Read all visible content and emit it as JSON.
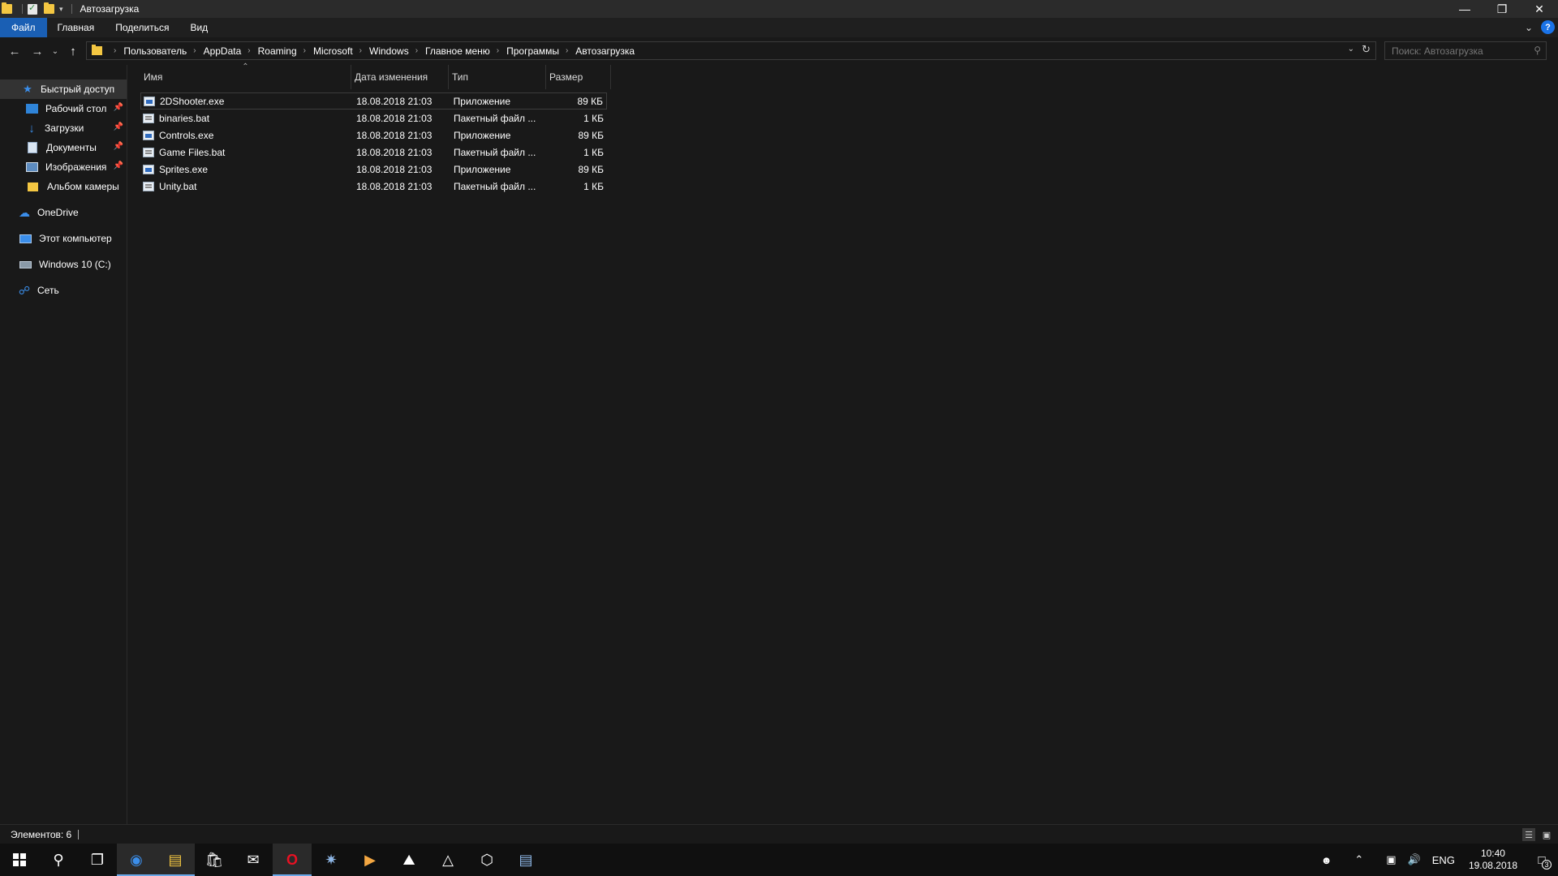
{
  "window": {
    "title": "Автозагрузка",
    "qat_dropdown": "▾"
  },
  "ribbon": {
    "tabs": [
      "Файл",
      "Главная",
      "Поделиться",
      "Вид"
    ],
    "help": "?"
  },
  "address": {
    "breadcrumbs": [
      "Пользователь",
      "AppData",
      "Roaming",
      "Microsoft",
      "Windows",
      "Главное меню",
      "Программы",
      "Автозагрузка"
    ]
  },
  "search": {
    "placeholder": "Поиск: Автозагрузка"
  },
  "sidebar": {
    "items": [
      {
        "label": "Быстрый доступ",
        "icon": "star-icon"
      },
      {
        "label": "Рабочий стол",
        "icon": "desktop-icon"
      },
      {
        "label": "Загрузки",
        "icon": "download-icon"
      },
      {
        "label": "Документы",
        "icon": "documents-icon"
      },
      {
        "label": "Изображения",
        "icon": "pictures-icon"
      },
      {
        "label": "Альбом камеры",
        "icon": "folder-icon"
      },
      {
        "label": "OneDrive",
        "icon": "cloud-icon"
      },
      {
        "label": "Этот компьютер",
        "icon": "computer-icon"
      },
      {
        "label": "Windows 10 (C:)",
        "icon": "drive-icon"
      },
      {
        "label": "Сеть",
        "icon": "network-icon"
      }
    ]
  },
  "list": {
    "columns": [
      "Имя",
      "Дата изменения",
      "Тип",
      "Размер"
    ],
    "rows": [
      {
        "name": "2DShooter.exe",
        "date": "18.08.2018 21:03",
        "type": "Приложение",
        "size": "89 КБ",
        "kind": "exe"
      },
      {
        "name": "binaries.bat",
        "date": "18.08.2018 21:03",
        "type": "Пакетный файл ...",
        "size": "1 КБ",
        "kind": "bat"
      },
      {
        "name": "Controls.exe",
        "date": "18.08.2018 21:03",
        "type": "Приложение",
        "size": "89 КБ",
        "kind": "exe"
      },
      {
        "name": "Game Files.bat",
        "date": "18.08.2018 21:03",
        "type": "Пакетный файл ...",
        "size": "1 КБ",
        "kind": "bat"
      },
      {
        "name": "Sprites.exe",
        "date": "18.08.2018 21:03",
        "type": "Приложение",
        "size": "89 КБ",
        "kind": "exe"
      },
      {
        "name": "Unity.bat",
        "date": "18.08.2018 21:03",
        "type": "Пакетный файл ...",
        "size": "1 КБ",
        "kind": "bat"
      }
    ]
  },
  "status": {
    "items_label": "Элементов: 6"
  },
  "taskbar": {
    "language": "ENG",
    "time": "10:40",
    "date": "19.08.2018",
    "notification_count": "3"
  },
  "colors": {
    "accent": "#1a5fb4",
    "background": "#191919",
    "folder": "#f4c742"
  }
}
